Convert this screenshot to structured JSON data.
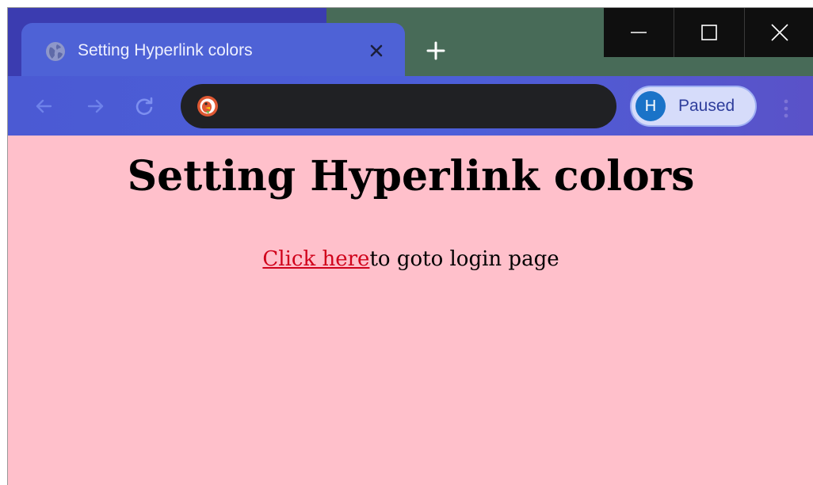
{
  "browser": {
    "tab": {
      "title": "Setting Hyperlink colors",
      "favicon": "globe-icon"
    },
    "new_tab_icon": "plus-icon",
    "window_controls": [
      "minimize-icon",
      "maximize-icon",
      "close-icon"
    ],
    "toolbar": {
      "nav_icons": [
        "back-arrow-icon",
        "forward-arrow-icon",
        "reload-icon"
      ],
      "address_bar": {
        "value": "",
        "search_engine_icon": "duckduckgo-icon"
      },
      "profile": {
        "initial": "H",
        "status": "Paused"
      },
      "menu_icon": "kebab-menu-icon"
    },
    "colors": {
      "titlebar_left": "#3b3cb0",
      "titlebar_right": "#486b58",
      "tab": "#4e62d6",
      "toolbar": "#4c5fd9",
      "omnibox": "#202124",
      "page_background": "#ffc0cb",
      "link": "#d0021b"
    }
  },
  "page": {
    "heading": "Setting Hyperlink colors",
    "link_text": "Click here",
    "line_rest": "to goto login page"
  }
}
